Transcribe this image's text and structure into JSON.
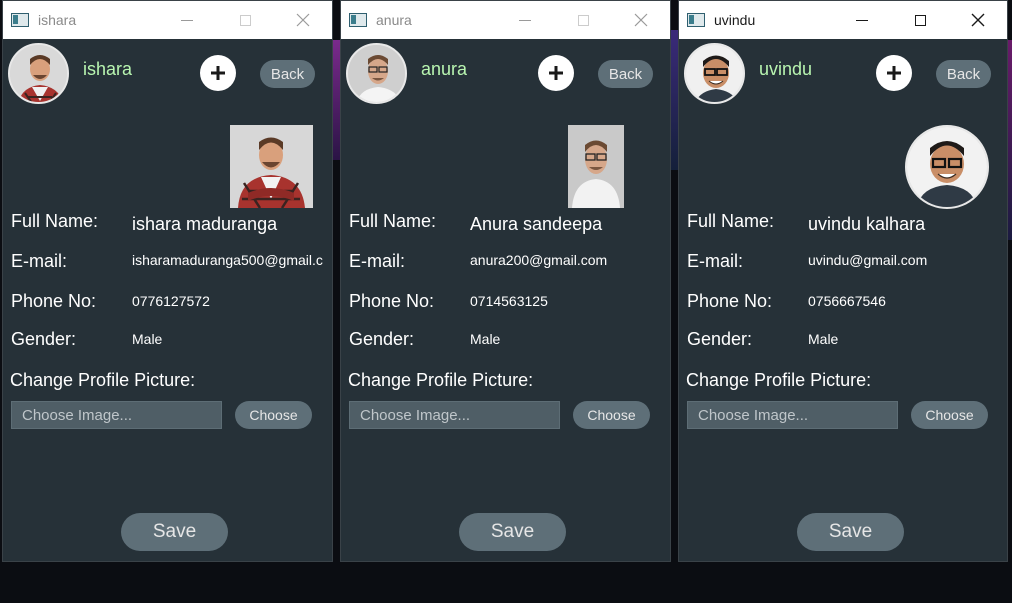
{
  "windows": [
    {
      "title": "ishara",
      "username": "ishara",
      "back_label": "Back",
      "fields": {
        "full_name_label": "Full Name:",
        "full_name": "ishara maduranga",
        "email_label": "E-mail:",
        "email": "isharamaduranga500@gmail.c",
        "phone_label": "Phone No:",
        "phone": "0776127572",
        "gender_label": "Gender:",
        "gender": "Male"
      },
      "change_picture_label": "Change Profile Picture:",
      "image_placeholder": "Choose Image...",
      "choose_label": "Choose",
      "save_label": "Save"
    },
    {
      "title": "anura",
      "username": "anura",
      "back_label": "Back",
      "fields": {
        "full_name_label": "Full Name:",
        "full_name": "Anura sandeepa",
        "email_label": "E-mail:",
        "email": "anura200@gmail.com",
        "phone_label": "Phone No:",
        "phone": "0714563125",
        "gender_label": "Gender:",
        "gender": "Male"
      },
      "change_picture_label": "Change Profile Picture:",
      "image_placeholder": "Choose Image...",
      "choose_label": "Choose",
      "save_label": "Save"
    },
    {
      "title": "uvindu",
      "username": "uvindu",
      "back_label": "Back",
      "fields": {
        "full_name_label": "Full Name:",
        "full_name": "uvindu kalhara",
        "email_label": "E-mail:",
        "email": "uvindu@gmail.com",
        "phone_label": "Phone No:",
        "phone": "0756667546",
        "gender_label": "Gender:",
        "gender": "Male"
      },
      "change_picture_label": "Change Profile Picture:",
      "image_placeholder": "Choose Image...",
      "choose_label": "Choose",
      "save_label": "Save"
    }
  ],
  "colors": {
    "window_bg": "#263138",
    "username": "#b8f5b0",
    "button": "#5e6f78",
    "input": "#4f5e66"
  },
  "icons": [
    "app-icon",
    "minimize-icon",
    "maximize-icon",
    "close-icon",
    "plus-icon"
  ]
}
